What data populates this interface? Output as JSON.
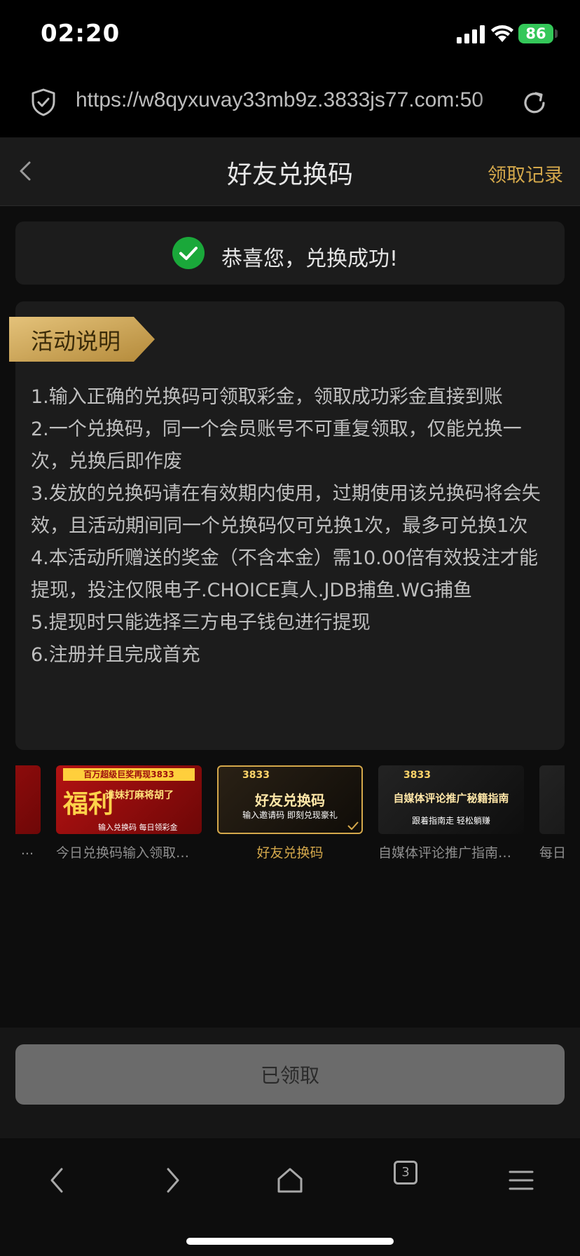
{
  "status_bar": {
    "time": "02:20",
    "battery": "86"
  },
  "browser": {
    "url": "https://w8qyxuvay33mb9z.3833js77.com:50",
    "tab_count": "3"
  },
  "header": {
    "title": "好友兑换码",
    "records_label": "领取记录"
  },
  "success": {
    "message": "恭喜您，兑换成功!"
  },
  "rules": {
    "tab_label": "活动说明",
    "items": [
      "1.输入正确的兑换码可领取彩金，领取成功彩金直接到账",
      "2.一个兑换码，同一个会员账号不可重复领取，仅能兑换一次，兑换后即作废",
      "3.发放的兑换码请在有效期内使用，过期使用该兑换码将会失效，且活动期间同一个兑换码仅可兑换1次，最多可兑换1次",
      "4.本活动所赠送的奖金（不含本金）需10.00倍有效投注才能提现，投注仅限电子.CHOICE真人.JDB捕鱼.WG捕鱼",
      "5.提现时只能选择三方电子钱包进行提现",
      "6.注册并且完成首充"
    ]
  },
  "carousel": {
    "cards": [
      {
        "label": "..."
      },
      {
        "label": "今日兑换码输入领取彩...",
        "thumb_banner": "百万超级巨奖再现3833",
        "thumb_glyph": "福利",
        "thumb_title": "谁妹打麻将胡了",
        "thumb_sub": "输入兑换码 每日领彩金"
      },
      {
        "label": "好友兑换码",
        "thumb_badge": "3833",
        "thumb_title": "好友兑换码",
        "thumb_sub": "输入邀请码 即刻兑现豪礼"
      },
      {
        "label": "自媒体评论推广指南详...",
        "thumb_badge": "3833",
        "thumb_title": "自媒体评论推广秘籍指南",
        "thumb_sub": "跟着指南走 轻松躺赚"
      },
      {
        "label": "每日"
      }
    ]
  },
  "footer": {
    "button_label": "已领取"
  },
  "colors": {
    "accent": "#d4a84b",
    "success": "#1aa83a",
    "background": "#0d0d0d"
  }
}
